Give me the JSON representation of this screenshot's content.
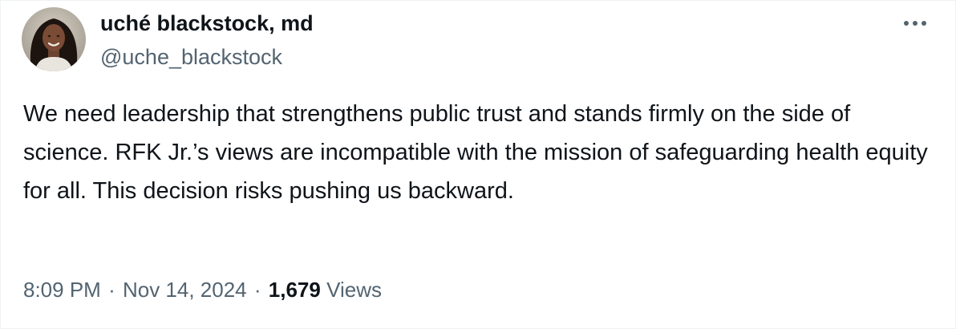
{
  "author": {
    "display_name": "uché blackstock, md",
    "handle": "@uche_blackstock",
    "avatar_icon": "profile-photo"
  },
  "menu": {
    "more_icon": "more-horizontal-icon"
  },
  "tweet": {
    "text": "We need leadership that strengthens public trust and stands firmly on the side of science. RFK Jr.’s views are incompatible with the mission of safeguarding health equity for all. This decision risks pushing us backward."
  },
  "meta": {
    "time": "8:09 PM",
    "separator": "·",
    "date": "Nov 14, 2024",
    "views_count": "1,679",
    "views_label": "Views"
  },
  "colors": {
    "text_primary": "#0f1419",
    "text_secondary": "#536471",
    "background": "#ffffff"
  }
}
